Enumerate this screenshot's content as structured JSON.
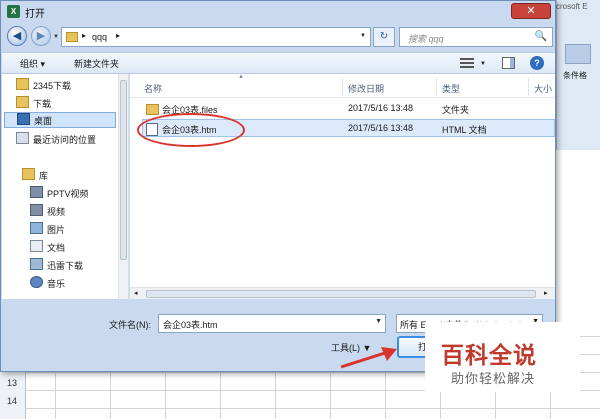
{
  "window": {
    "title": "打开",
    "app_icon": "X",
    "close": "✕"
  },
  "background_app": {
    "title_fragment": "crosoft E",
    "ribbon_label": "条件格",
    "row_numbers": [
      "13",
      "14"
    ]
  },
  "address": {
    "path": [
      "qqq"
    ],
    "search_placeholder": "搜索 qqq"
  },
  "toolbar": {
    "organize": "组织 ▾",
    "new_folder": "新建文件夹"
  },
  "nav": {
    "items": [
      {
        "label": "2345下载",
        "icon": "folder-icon"
      },
      {
        "label": "下载",
        "icon": "folder-icon"
      },
      {
        "label": "桌面",
        "icon": "desktop-icon",
        "selected": true
      },
      {
        "label": "最近访问的位置",
        "icon": "recent-icon"
      },
      {
        "label": "库",
        "icon": "library-icon"
      },
      {
        "label": "PPTV视频",
        "icon": "video-lib-icon"
      },
      {
        "label": "视频",
        "icon": "video-lib-icon"
      },
      {
        "label": "图片",
        "icon": "picture-lib-icon"
      },
      {
        "label": "文档",
        "icon": "document-lib-icon"
      },
      {
        "label": "迅雷下载",
        "icon": "download-lib-icon"
      },
      {
        "label": "音乐",
        "icon": "music-lib-icon"
      }
    ]
  },
  "files": {
    "columns": [
      "名称",
      "修改日期",
      "类型",
      "大小"
    ],
    "rows": [
      {
        "name": "会企03表.files",
        "date": "2017/5/16 13:48",
        "type": "文件夹",
        "icon": "folder-icon"
      },
      {
        "name": "会企03表.htm",
        "date": "2017/5/16 13:48",
        "type": "HTML 文档",
        "icon": "html-file-icon",
        "selected": true
      }
    ]
  },
  "bottom": {
    "filename_label": "文件名(N):",
    "filename_value": "会企03表.htm",
    "filetype_value": "所有 Excel 文件(*.xl*;*.xlsx;*.xl",
    "tools_label": "工具(L)",
    "open_label": "打开"
  },
  "watermark": {
    "title": "百科全说",
    "subtitle": "助你轻松解决"
  },
  "colors": {
    "accent": "#3a8ee6",
    "annotation": "#d9342b",
    "watermark": "#c0392b"
  }
}
